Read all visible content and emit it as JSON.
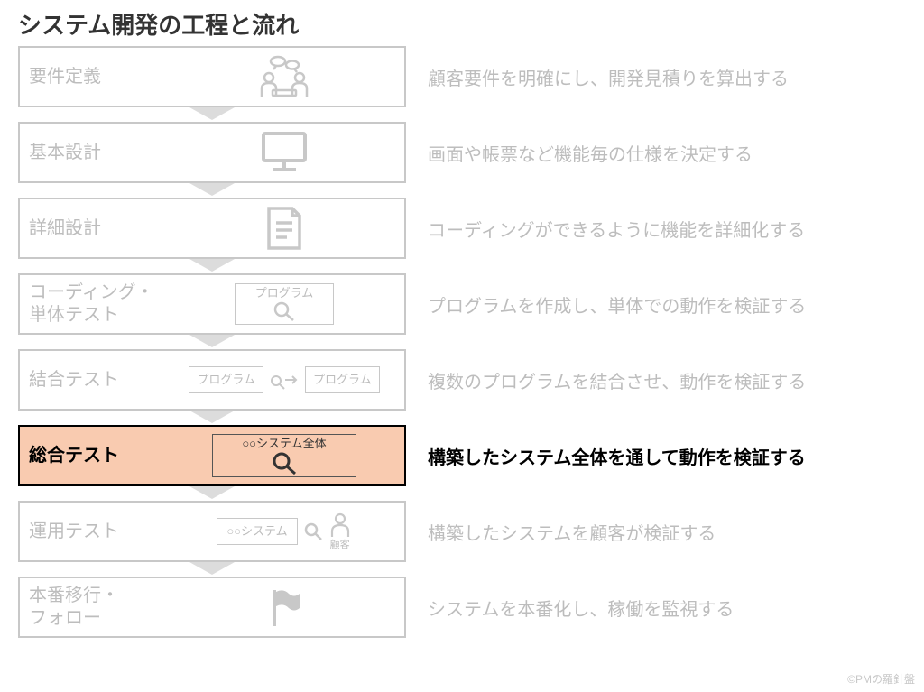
{
  "title": "システム開発の工程と流れ",
  "credit": "©PMの羅針盤",
  "stages": [
    {
      "label": "要件定義",
      "desc": "顧客要件を明確にし、開発見積りを算出する",
      "icon": "meeting",
      "active": false
    },
    {
      "label": "基本設計",
      "desc": "画面や帳票など機能毎の仕様を決定する",
      "icon": "monitor",
      "active": false
    },
    {
      "label": "詳細設計",
      "desc": "コーディングができるように機能を詳細化する",
      "icon": "document",
      "active": false
    },
    {
      "label": "コーディング・\n単体テスト",
      "desc": "プログラムを作成し、単体での動作を検証する",
      "icon": "program-search",
      "sub_label": "プログラム",
      "active": false
    },
    {
      "label": "結合テスト",
      "desc": "複数のプログラムを結合させ、動作を検証する",
      "icon": "program-link",
      "sub_label": "プログラム",
      "active": false
    },
    {
      "label": "総合テスト",
      "desc": "構築したシステム全体を通して動作を検証する",
      "icon": "system-search",
      "sub_label": "○○システム全体",
      "active": true
    },
    {
      "label": "運用テスト",
      "desc": "構築したシステムを顧客が検証する",
      "icon": "system-user",
      "sub_label": "○○システム",
      "caption": "顧客",
      "active": false
    },
    {
      "label": "本番移行・\nフォロー",
      "desc": "システムを本番化し、稼働を監視する",
      "icon": "flag",
      "active": false
    }
  ]
}
